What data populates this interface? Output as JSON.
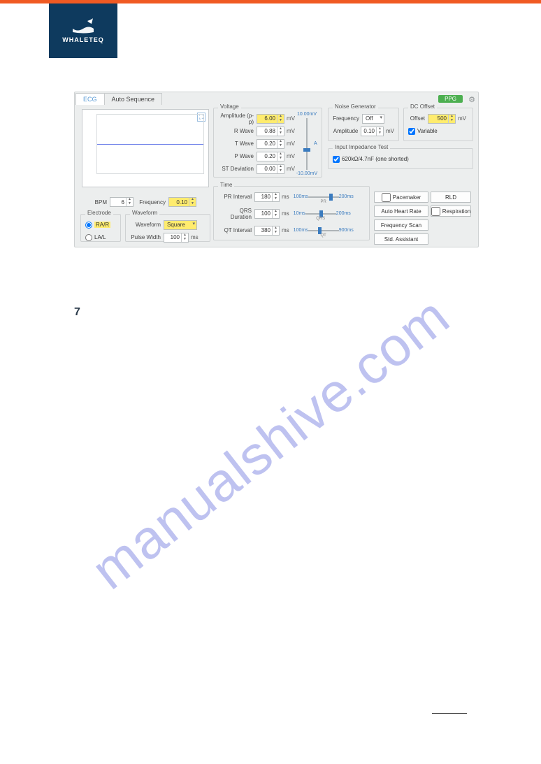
{
  "brand": "WHALETEQ",
  "tabs": {
    "ecg": "ECG",
    "auto": "Auto Sequence"
  },
  "ppg_label": "PPG",
  "bpm": {
    "label": "BPM",
    "value": "6"
  },
  "frequency_main": {
    "label": "Frequency",
    "value": "0.10"
  },
  "electrode": {
    "title": "Electrode",
    "rar": "RA/R",
    "lal": "LA/L"
  },
  "waveform": {
    "title": "Waveform",
    "waveform_label": "Waveform",
    "waveform_value": "Square",
    "pulse_width_label": "Pulse Width",
    "pulse_width_value": "100",
    "pulse_width_unit": "ms"
  },
  "voltage": {
    "title": "Voltage",
    "amp_label": "Amplitude (p-p)",
    "amp_value": "6.00",
    "r_label": "R Wave",
    "r_value": "0.88",
    "t_label": "T Wave",
    "t_value": "0.20",
    "p_label": "P Wave",
    "p_value": "0.20",
    "st_label": "ST Deviation",
    "st_value": "0.00",
    "unit": "mV",
    "slider_top": "10.00mV",
    "slider_bot": "-10.00mV",
    "slider_a": "A"
  },
  "noise": {
    "title": "Noise Generator",
    "freq_label": "Frequency",
    "freq_value": "Off",
    "amp_label": "Amplitude",
    "amp_value": "0.10",
    "unit": "mV"
  },
  "dc": {
    "title": "DC Offset",
    "offset_label": "Offset",
    "offset_value": "500",
    "unit": "mV",
    "variable": "Variable"
  },
  "impedance": {
    "title": "Input Impedance Test",
    "opt": "620kΩ/4.7nF (one shorted)"
  },
  "time": {
    "title": "Time",
    "pr_label": "PR Interval",
    "pr_value": "180",
    "qrs_label": "QRS Duration",
    "qrs_value": "100",
    "qt_label": "QT Interval",
    "qt_value": "380",
    "unit": "ms",
    "pr_range_lo": "100ms",
    "pr_range_hi": "200ms",
    "pr_tag": "PR",
    "qrs_range_lo": "10ms",
    "qrs_range_hi": "200ms",
    "qrs_tag": "QRS",
    "qt_range_lo": "100ms",
    "qt_range_hi": "900ms",
    "qt_tag": "QT"
  },
  "buttons": {
    "pacemaker": "Pacemaker",
    "rld": "RLD",
    "auto_hr": "Auto Heart Rate",
    "respiration": "Respiration",
    "freq_scan": "Frequency Scan",
    "std_asst": "Std. Assistant"
  },
  "heading": "7",
  "watermark": "manualshive.com"
}
